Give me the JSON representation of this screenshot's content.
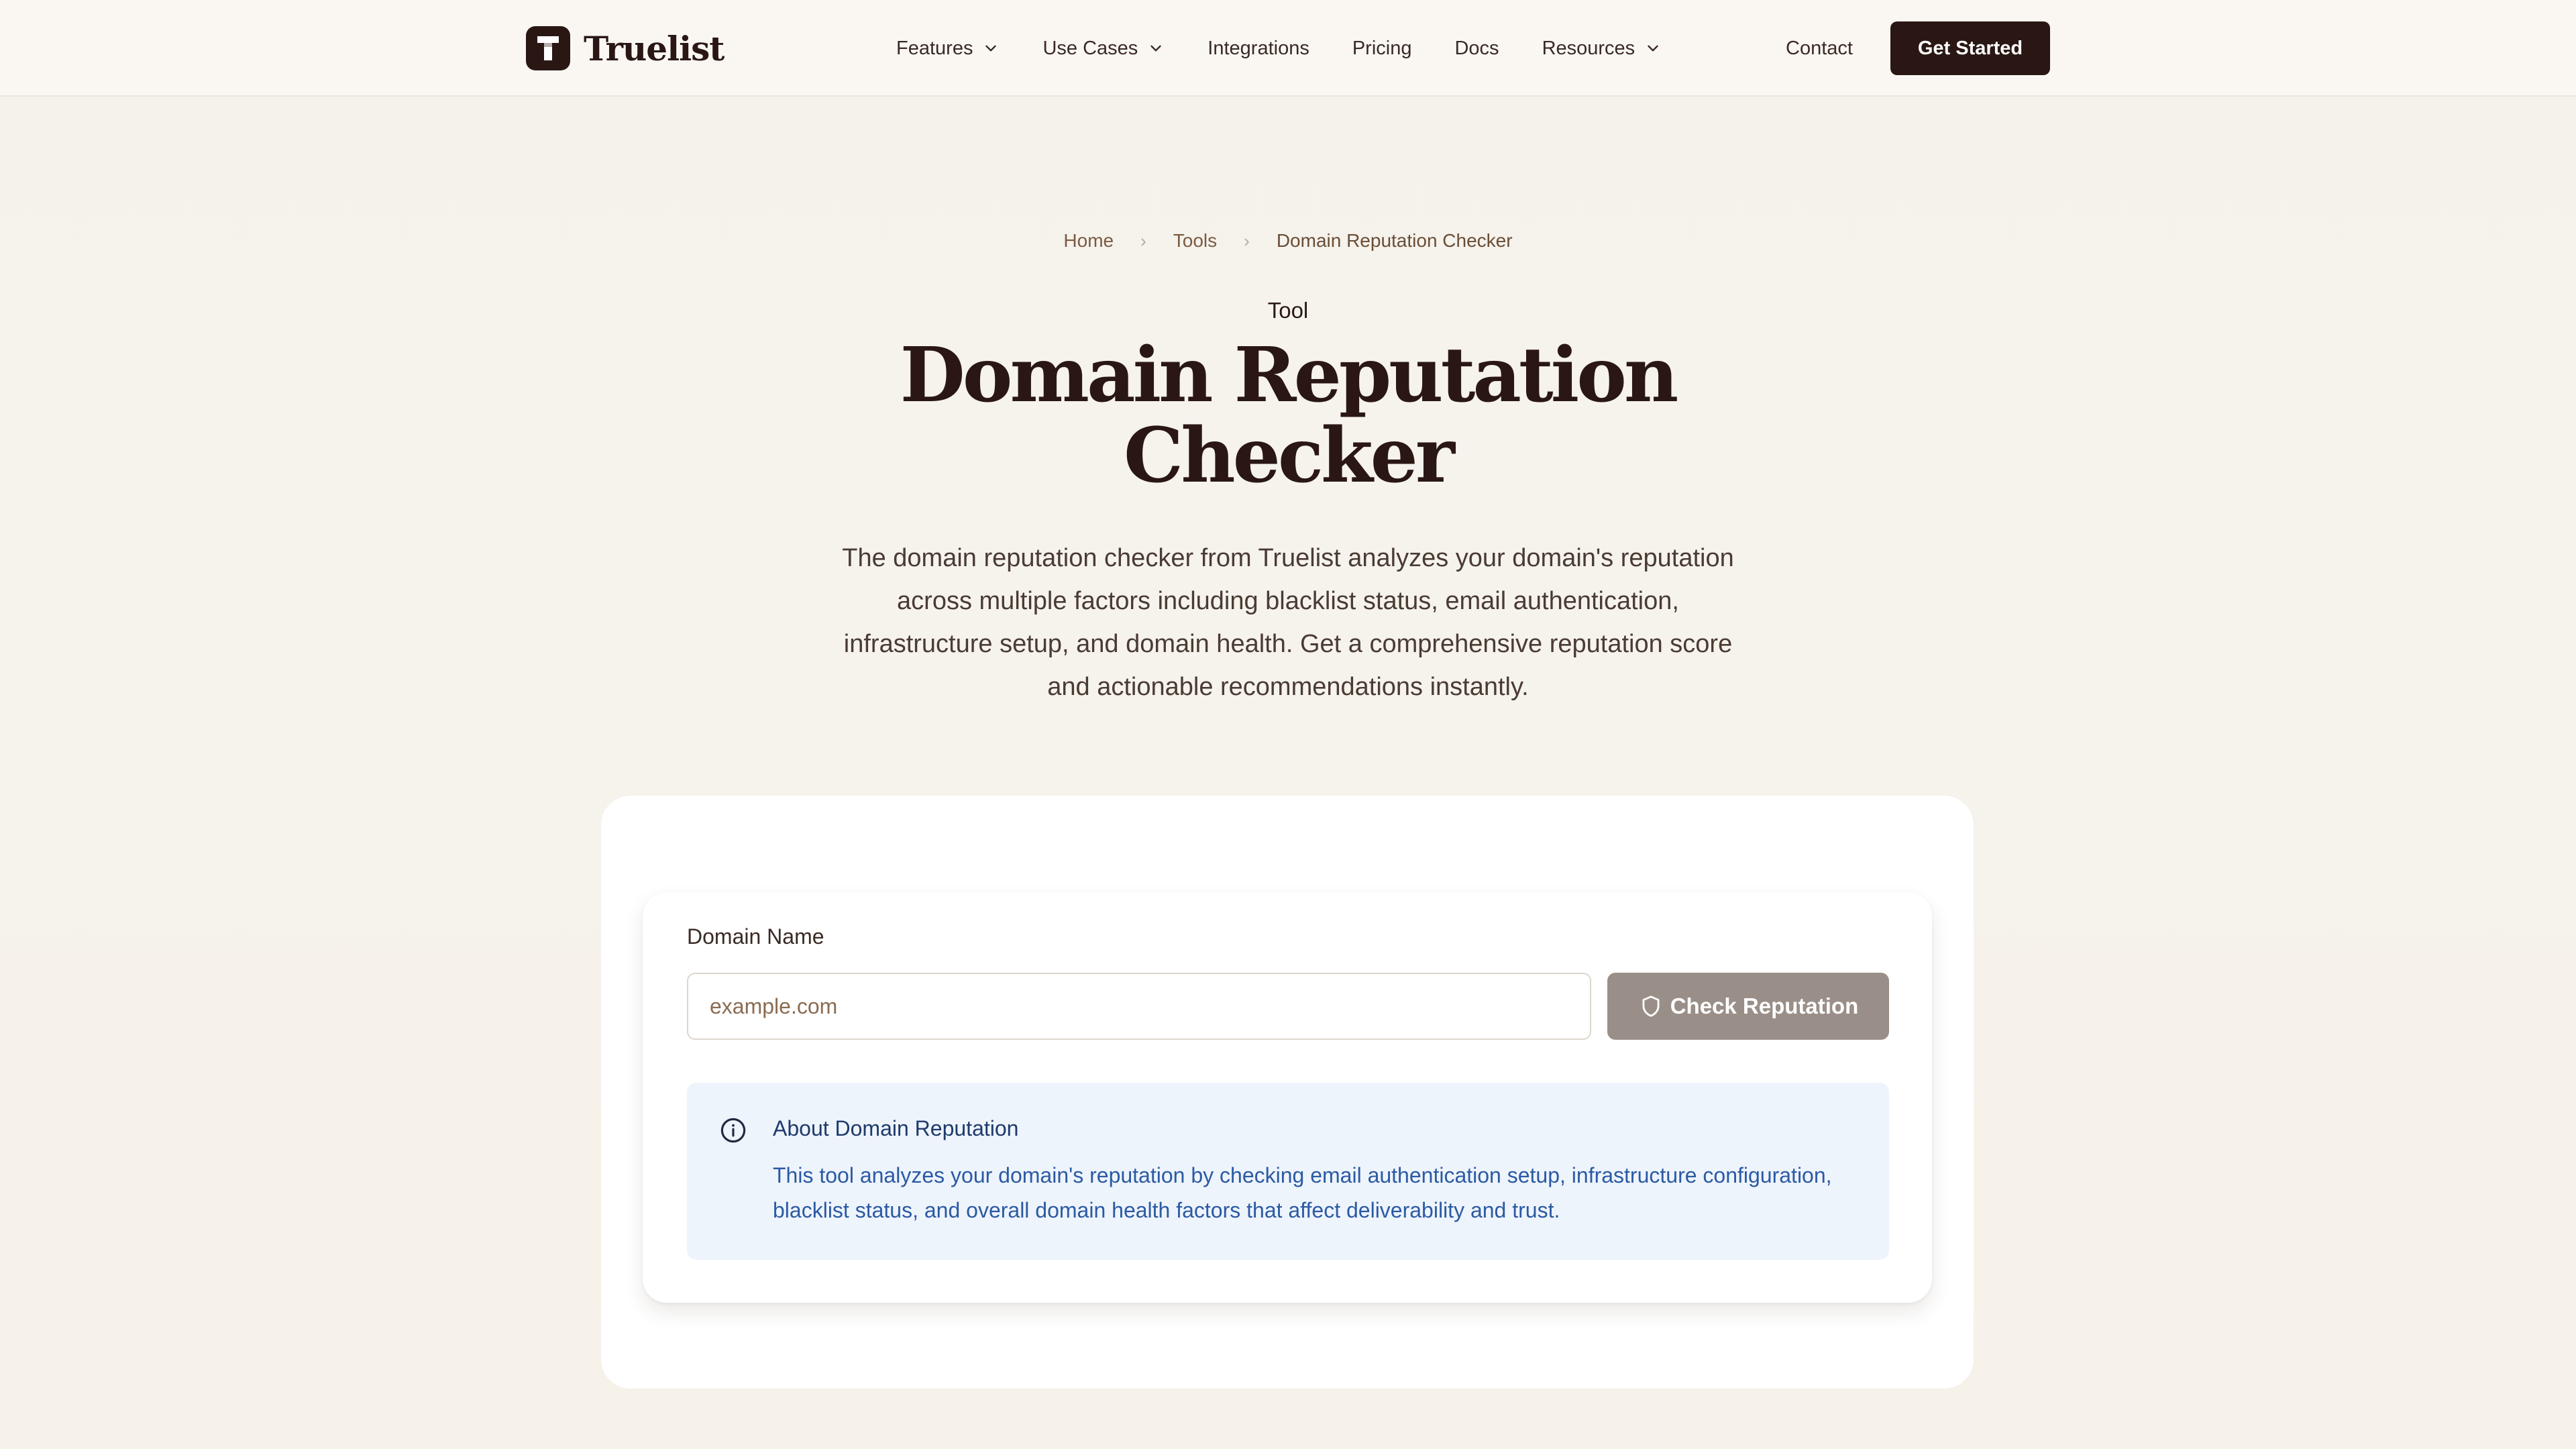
{
  "header": {
    "logo_text": "Truelist",
    "nav": [
      {
        "label": "Features",
        "has_dropdown": true
      },
      {
        "label": "Use Cases",
        "has_dropdown": true
      },
      {
        "label": "Integrations",
        "has_dropdown": false
      },
      {
        "label": "Pricing",
        "has_dropdown": false
      },
      {
        "label": "Docs",
        "has_dropdown": false
      },
      {
        "label": "Resources",
        "has_dropdown": true
      }
    ],
    "contact_label": "Contact",
    "cta_label": "Get Started"
  },
  "breadcrumb": [
    "Home",
    "Tools",
    "Domain Reputation Checker"
  ],
  "hero": {
    "eyebrow": "Tool",
    "title_line1": "Domain Reputation",
    "title_line2": "Checker",
    "description": "The domain reputation checker from Truelist analyzes your domain's reputation across multiple factors including blacklist status, email authentication, infrastructure setup, and domain health. Get a comprehensive reputation score and actionable recommendations instantly."
  },
  "form": {
    "label": "Domain Name",
    "value": "",
    "placeholder": "example.com",
    "button_label": "Check Reputation",
    "button_icon": "shield-icon"
  },
  "info": {
    "icon": "info-icon",
    "title": "About Domain Reputation",
    "text": "This tool analyzes your domain's reputation by checking email authentication setup, infrastructure configuration, blacklist status, and overall domain health factors that affect deliverability and trust."
  },
  "colors": {
    "brand_dark": "#2a1713",
    "page_bg": "#f6f2eb",
    "button_disabled": "#9a8f88",
    "info_bg": "#eef4fc",
    "info_text": "#2b5aa3"
  }
}
